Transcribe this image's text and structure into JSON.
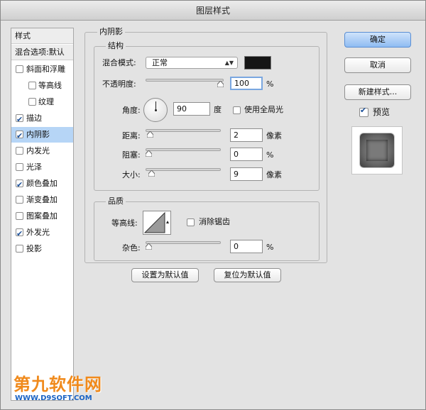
{
  "window": {
    "title": "图层样式"
  },
  "styles": {
    "header": "样式",
    "blend_options": "混合选项:默认",
    "items": [
      {
        "label": "斜面和浮雕",
        "checked": false,
        "sub": false,
        "selected": false
      },
      {
        "label": "等高线",
        "checked": false,
        "sub": true,
        "selected": false
      },
      {
        "label": "纹理",
        "checked": false,
        "sub": true,
        "selected": false
      },
      {
        "label": "描边",
        "checked": true,
        "sub": false,
        "selected": false
      },
      {
        "label": "内阴影",
        "checked": true,
        "sub": false,
        "selected": true
      },
      {
        "label": "内发光",
        "checked": false,
        "sub": false,
        "selected": false
      },
      {
        "label": "光泽",
        "checked": false,
        "sub": false,
        "selected": false
      },
      {
        "label": "颜色叠加",
        "checked": true,
        "sub": false,
        "selected": false
      },
      {
        "label": "渐变叠加",
        "checked": false,
        "sub": false,
        "selected": false
      },
      {
        "label": "图案叠加",
        "checked": false,
        "sub": false,
        "selected": false
      },
      {
        "label": "外发光",
        "checked": true,
        "sub": false,
        "selected": false
      },
      {
        "label": "投影",
        "checked": false,
        "sub": false,
        "selected": false
      }
    ]
  },
  "inner_shadow": {
    "title": "内阴影",
    "structure": {
      "title": "结构",
      "blend_mode_label": "混合模式:",
      "blend_mode_value": "正常",
      "shadow_color": "#151515",
      "opacity_label": "不透明度:",
      "opacity_value": "100",
      "opacity_unit": "%",
      "opacity_level": 1.0,
      "angle_label": "角度:",
      "angle_value": "90",
      "angle_unit": "度",
      "global_light_label": "使用全局光",
      "global_light_checked": false,
      "distance_label": "距离:",
      "distance_value": "2",
      "distance_unit": "像素",
      "distance_level": 0.02,
      "choke_label": "阻塞:",
      "choke_value": "0",
      "choke_unit": "%",
      "choke_level": 0.0,
      "size_label": "大小:",
      "size_value": "9",
      "size_unit": "像素",
      "size_level": 0.04
    },
    "quality": {
      "title": "品质",
      "contour_label": "等高线:",
      "anti_alias_label": "消除锯齿",
      "anti_alias_checked": false,
      "noise_label": "杂色:",
      "noise_value": "0",
      "noise_unit": "%",
      "noise_level": 0.0
    },
    "make_default_label": "设置为默认值",
    "reset_default_label": "复位为默认值"
  },
  "actions": {
    "ok_label": "确定",
    "cancel_label": "取消",
    "new_style_label": "新建样式...",
    "preview_label": "预览",
    "preview_checked": true
  },
  "watermark": {
    "main": "第九软件网",
    "sub": "WWW.D9SOFT.COM"
  }
}
